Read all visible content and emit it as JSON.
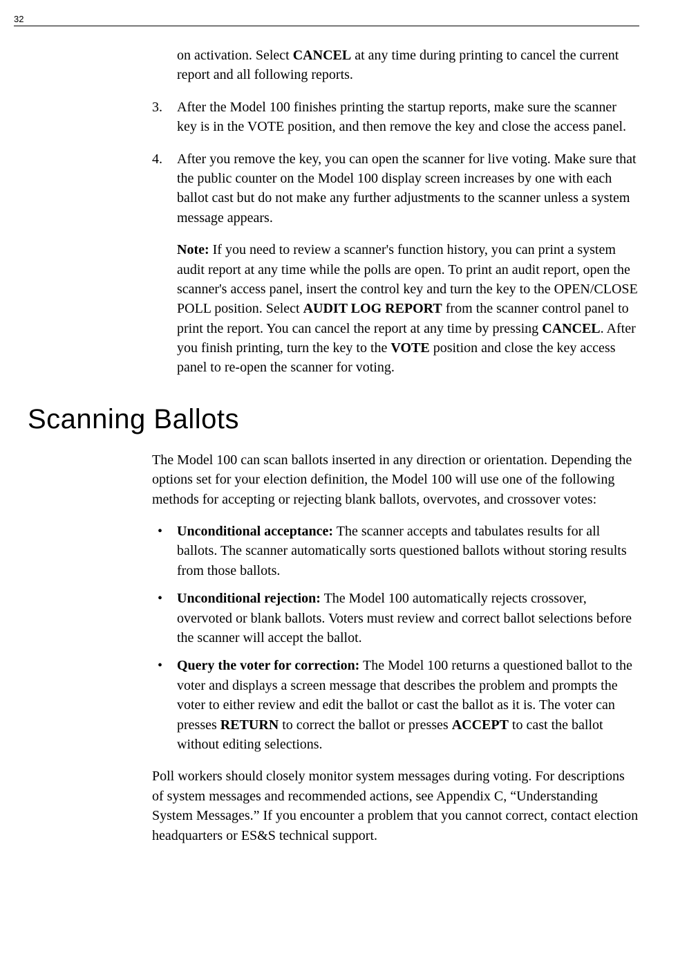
{
  "pageNumber": "32",
  "continuation": {
    "pre": "on activation. Select ",
    "cancel": "CANCEL",
    "post": " at any time during printing to cancel the current report and all following reports."
  },
  "steps": [
    {
      "num": "3.",
      "text": "After the Model 100 finishes printing the startup reports, make sure the scanner key is in the VOTE position, and then remove the key and close the access panel."
    },
    {
      "num": "4.",
      "text": "After you remove the key, you can open the scanner for live voting. Make sure that the public counter on the Model 100 display screen increases by one with each ballot cast but do not make any further adjustments to the scanner unless a system message appears."
    }
  ],
  "note": {
    "label": "Note:",
    "seg1": " If you need to review a scanner's function history, you can print a system audit report at any time while the polls are open. To print an audit report, open the scanner's access panel, insert the control key and turn the key to the OPEN/CLOSE POLL position. Select ",
    "audit": "AUDIT LOG REPORT",
    "seg2": " from the scanner control panel to print the report. You can cancel the report at any time by pressing ",
    "cancel": "CANCEL",
    "seg3": ". After you finish printing, turn the key to the ",
    "vote": "VOTE",
    "seg4": " position and close the key access panel to re-open the scanner for voting."
  },
  "sectionHeading": "Scanning Ballots",
  "intro": "The Model 100 can scan ballots inserted in any direction or orientation. Depending the options set for your election definition, the Model 100 will use one of the following methods for accepting or rejecting blank ballots, overvotes, and crossover votes:",
  "bullets": [
    {
      "label": "Unconditional acceptance:",
      "text": " The scanner accepts and tabulates results for all ballots. The scanner automatically sorts questioned ballots without storing results from those ballots."
    },
    {
      "label": "Unconditional rejection:",
      "text": " The Model 100 automatically rejects crossover, overvoted or blank ballots. Voters must review and correct ballot selections before the scanner will accept the ballot."
    }
  ],
  "bullet3": {
    "label": "Query the voter for correction:",
    "seg1": " The Model 100 returns a questioned ballot to the voter and displays a screen message that describes the problem and prompts the voter to either review and edit the ballot or cast the ballot as it is. The voter can presses ",
    "return": "RETURN",
    "seg2": " to correct the ballot or presses ",
    "accept": "ACCEPT",
    "seg3": " to cast the ballot without editing selections."
  },
  "closing": "Poll workers should closely monitor system messages during voting. For descriptions of system messages and recommended actions, see Appendix C, “Understanding System Messages.” If you encounter a problem that you cannot correct, contact election headquarters or ES&S technical support."
}
